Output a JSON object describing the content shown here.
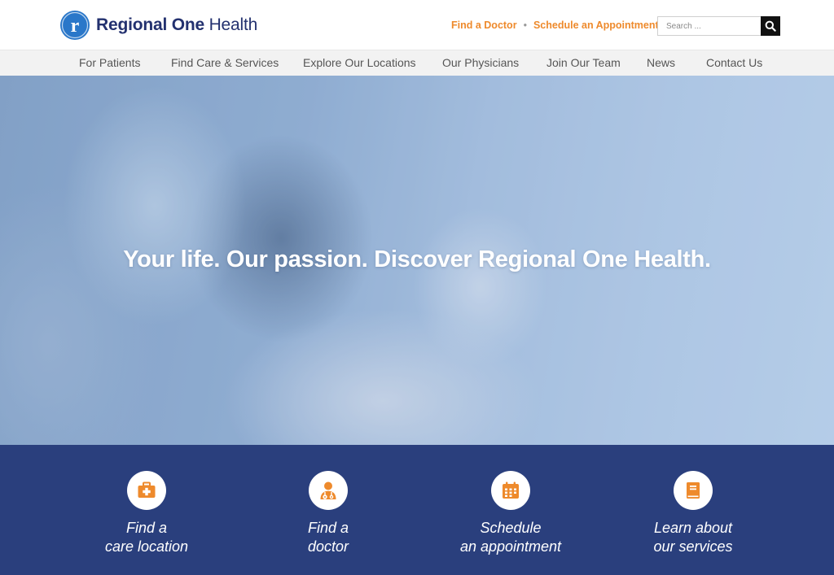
{
  "brand": {
    "name_bold": "Regional One",
    "name_light": " Health",
    "logo_letter": "r",
    "accent": "#ee8a2c",
    "navy": "#2a3f7d"
  },
  "utility": {
    "find_doctor": "Find a Doctor",
    "separator": "•",
    "schedule": "Schedule an Appointment"
  },
  "search": {
    "placeholder": "Search ...",
    "icon": "search-icon"
  },
  "nav": {
    "items": [
      {
        "label": "For Patients"
      },
      {
        "label": "Find Care & Services"
      },
      {
        "label": "Explore Our Locations"
      },
      {
        "label": "Our Physicians"
      },
      {
        "label": "Join Our Team"
      },
      {
        "label": "News"
      },
      {
        "label": "Contact Us"
      }
    ]
  },
  "hero": {
    "title": "Your life. Our passion. Discover Regional One Health."
  },
  "quick_links": [
    {
      "icon": "first-aid-kit-icon",
      "line1": "Find a",
      "line2": "care location"
    },
    {
      "icon": "doctor-icon",
      "line1": "Find a",
      "line2": "doctor"
    },
    {
      "icon": "calendar-icon",
      "line1": "Schedule",
      "line2": "an appointment"
    },
    {
      "icon": "book-icon",
      "line1": "Learn about",
      "line2": "our services"
    }
  ]
}
